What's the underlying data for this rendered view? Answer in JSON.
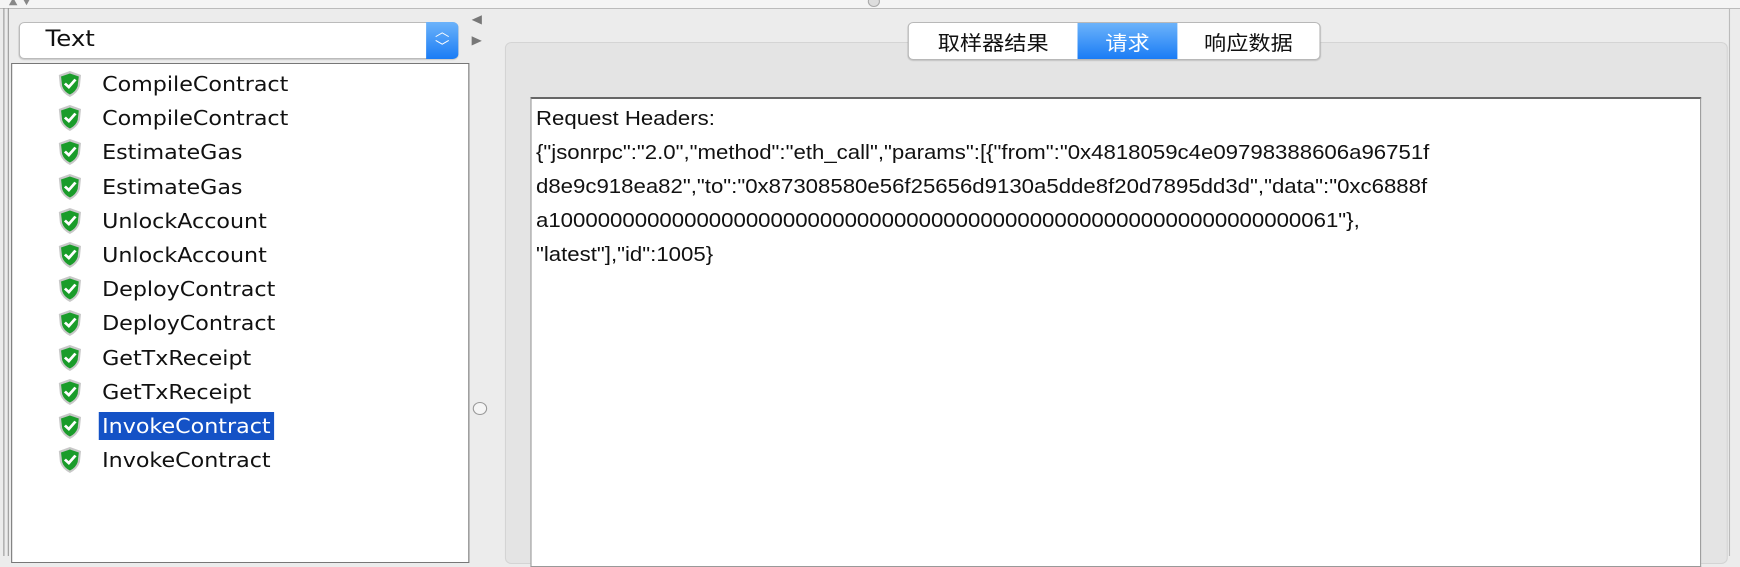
{
  "view_selector": {
    "value": "Text"
  },
  "results_tree": {
    "items": [
      {
        "label": "CompileContract",
        "status": "success"
      },
      {
        "label": "CompileContract",
        "status": "success"
      },
      {
        "label": "EstimateGas",
        "status": "success"
      },
      {
        "label": "EstimateGas",
        "status": "success"
      },
      {
        "label": "UnlockAccount",
        "status": "success"
      },
      {
        "label": "UnlockAccount",
        "status": "success"
      },
      {
        "label": "DeployContract",
        "status": "success"
      },
      {
        "label": "DeployContract",
        "status": "success"
      },
      {
        "label": "GetTxReceipt",
        "status": "success"
      },
      {
        "label": "GetTxReceipt",
        "status": "success"
      },
      {
        "label": "InvokeContract",
        "status": "success",
        "selected": true
      },
      {
        "label": "InvokeContract",
        "status": "success"
      }
    ]
  },
  "tabs": [
    {
      "label": "取样器结果"
    },
    {
      "label": "请求",
      "active": true
    },
    {
      "label": "响应数据"
    }
  ],
  "request": {
    "lines": [
      "Request Headers:",
      "{\"jsonrpc\":\"2.0\",\"method\":\"eth_call\",\"params\":[{\"from\":\"0x4818059c4e09798388606a96751f",
      "d8e9c918ea82\",\"to\":\"0x87308580e56f25656d9130a5dde8f20d7895dd3d\",\"data\":\"0xc6888f",
      "a1000000000000000000000000000000000000000000000000000000000000061\"},",
      "\"latest\"],\"id\":1005}"
    ]
  },
  "colors": {
    "accent": "#1a7cf5",
    "selection": "#1452c6",
    "success_icon": "#1a9c2a"
  }
}
